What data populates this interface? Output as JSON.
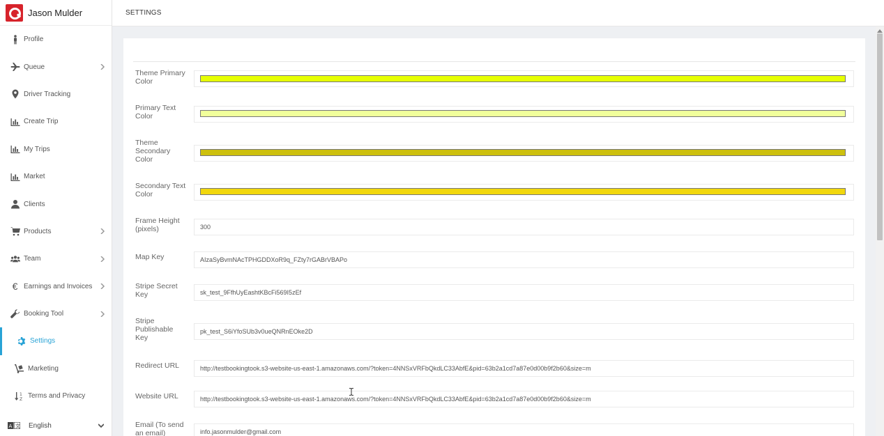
{
  "user": {
    "name": "Jason Mulder"
  },
  "page": {
    "title": "SETTINGS"
  },
  "sidebar": {
    "items": [
      {
        "label": "Profile",
        "icon": "person-icon",
        "chevron": false
      },
      {
        "label": "Queue",
        "icon": "plane-icon",
        "chevron": true
      },
      {
        "label": "Driver Tracking",
        "icon": "map-pin-icon",
        "chevron": false
      },
      {
        "label": "Create Trip",
        "icon": "bar-chart-icon",
        "chevron": false
      },
      {
        "label": "My Trips",
        "icon": "bar-chart-icon",
        "chevron": false
      },
      {
        "label": "Market",
        "icon": "bar-chart-icon",
        "chevron": false
      },
      {
        "label": "Clients",
        "icon": "user-icon",
        "chevron": false
      },
      {
        "label": "Products",
        "icon": "cart-icon",
        "chevron": true
      },
      {
        "label": "Team",
        "icon": "users-icon",
        "chevron": true
      },
      {
        "label": "Earnings and Invoices",
        "icon": "euro-icon",
        "chevron": true
      },
      {
        "label": "Booking Tool",
        "icon": "wrench-icon",
        "chevron": true
      },
      {
        "label": "Settings",
        "icon": "gear-icon",
        "chevron": false,
        "active": true
      },
      {
        "label": "Marketing",
        "icon": "dolly-icon",
        "chevron": false
      },
      {
        "label": "Terms and Privacy",
        "icon": "sort-icon",
        "chevron": false
      }
    ],
    "language": "English"
  },
  "settings": {
    "theme_primary": {
      "label": "Theme Primary Color",
      "color": "#e6ff00"
    },
    "primary_text": {
      "label": "Primary Text Color",
      "color": "#f1ff9b"
    },
    "theme_secondary": {
      "label": "Theme Secondary Color",
      "color": "#cdc00e"
    },
    "secondary_text": {
      "label": "Secondary Text Color",
      "color": "#f1d70d"
    },
    "frame_height": {
      "label": "Frame Height (pixels)",
      "value": "300"
    },
    "map_key": {
      "label": "Map Key",
      "value": "AIzaSyBvmNAcTPHGDDXoR9q_FZty7rGABrVBAPo"
    },
    "stripe_secret": {
      "label": "Stripe Secret Key",
      "value": "sk_test_9FfhUyEashtKBcFi569I5zEf"
    },
    "stripe_publishable": {
      "label": "Stripe Publishable Key",
      "value": "pk_test_S6iYfoSUb3v0ueQNRnEOke2D"
    },
    "redirect_url": {
      "label": "Redirect URL",
      "value": "http://testbookingtook.s3-website-us-east-1.amazonaws.com/?token=4NNSxVRFbQkdLC33AbfE&pid=63b2a1cd7a87e0d00b9f2b60&size=m"
    },
    "website_url": {
      "label": "Website URL",
      "value": "http://testbookingtook.s3-website-us-east-1.amazonaws.com/?token=4NNSxVRFbQkdLC33AbfE&pid=63b2a1cd7a87e0d00b9f2b60&size=m"
    },
    "email": {
      "label": "Email (To send an email)",
      "value": "info.jasonmulder@gmail.com"
    }
  },
  "colors": {
    "accent": "#29a3d6",
    "brand": "#d7232b"
  }
}
